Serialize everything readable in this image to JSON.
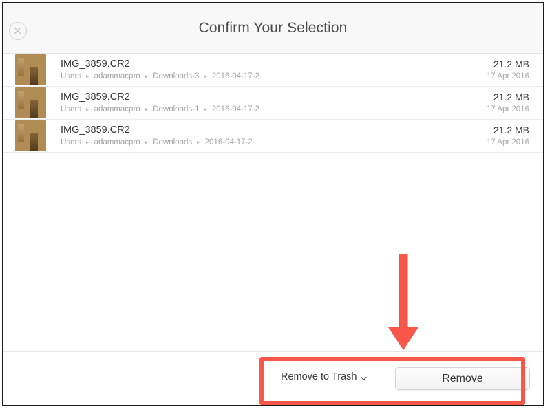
{
  "window": {
    "title": "Confirm Your Selection",
    "close_icon": "close-circle-icon"
  },
  "file_list": {
    "rows": [
      {
        "name": "IMG_3859.CR2",
        "path": [
          "Users",
          "adammacpro",
          "Downloads-3",
          "2016-04-17-2"
        ],
        "size": "21.2 MB",
        "date": "17 Apr 2016",
        "thumbnail": "photo-thumbnail"
      },
      {
        "name": "IMG_3859.CR2",
        "path": [
          "Users",
          "adammacpro",
          "Downloads-1",
          "2016-04-17-2"
        ],
        "size": "21.2 MB",
        "date": "17 Apr 2016",
        "thumbnail": "photo-thumbnail"
      },
      {
        "name": "IMG_3859.CR2",
        "path": [
          "Users",
          "adammacpro",
          "Downloads",
          "2016-04-17-2"
        ],
        "size": "21.2 MB",
        "date": "17 Apr 2016",
        "thumbnail": "photo-thumbnail"
      }
    ],
    "separator": "▸"
  },
  "bottom_bar": {
    "action_dropdown_label": "Remove to Trash",
    "dropdown_icon": "chevron-down-icon",
    "remove_button_label": "Remove"
  },
  "annotations": {
    "highlight_color": "#f9564a",
    "arrow_color": "#f9564a",
    "arrow_icon": "down-arrow-annotation"
  }
}
